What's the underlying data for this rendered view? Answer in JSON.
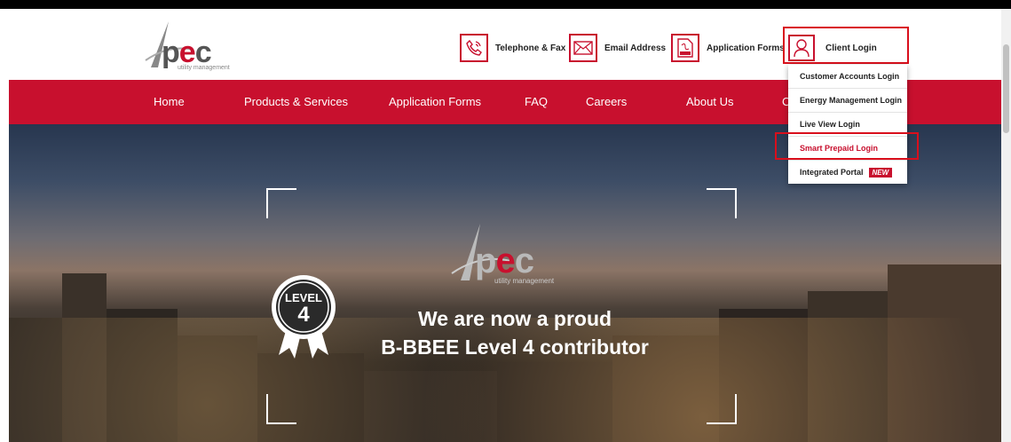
{
  "brand": {
    "name_pre": "p",
    "name_e": "e",
    "name_post": "c",
    "tagline": "utility management"
  },
  "header_links": [
    {
      "label": "Telephone & Fax",
      "icon": "phone-icon"
    },
    {
      "label": "Email Address",
      "icon": "envelope-icon"
    },
    {
      "label": "Application Forms",
      "icon": "pdf-icon"
    },
    {
      "label": "Client Login",
      "icon": "user-icon"
    }
  ],
  "nav": [
    "Home",
    "Products & Services",
    "Application Forms",
    "FAQ",
    "Careers",
    "About Us",
    "C"
  ],
  "dropdown": {
    "items": [
      {
        "label": "Customer Accounts Login"
      },
      {
        "label": "Energy Management Login"
      },
      {
        "label": "Live View Login"
      },
      {
        "label": "Smart Prepaid Login"
      },
      {
        "label": "Integrated Portal",
        "badge": "NEW"
      }
    ]
  },
  "hero": {
    "badge_top": "LEVEL",
    "badge_num": "4",
    "line1": "We are now a proud",
    "line2": "B-BBEE Level 4 contributor"
  },
  "colors": {
    "brand_red": "#c8102e",
    "highlight": "#d90f1c"
  }
}
